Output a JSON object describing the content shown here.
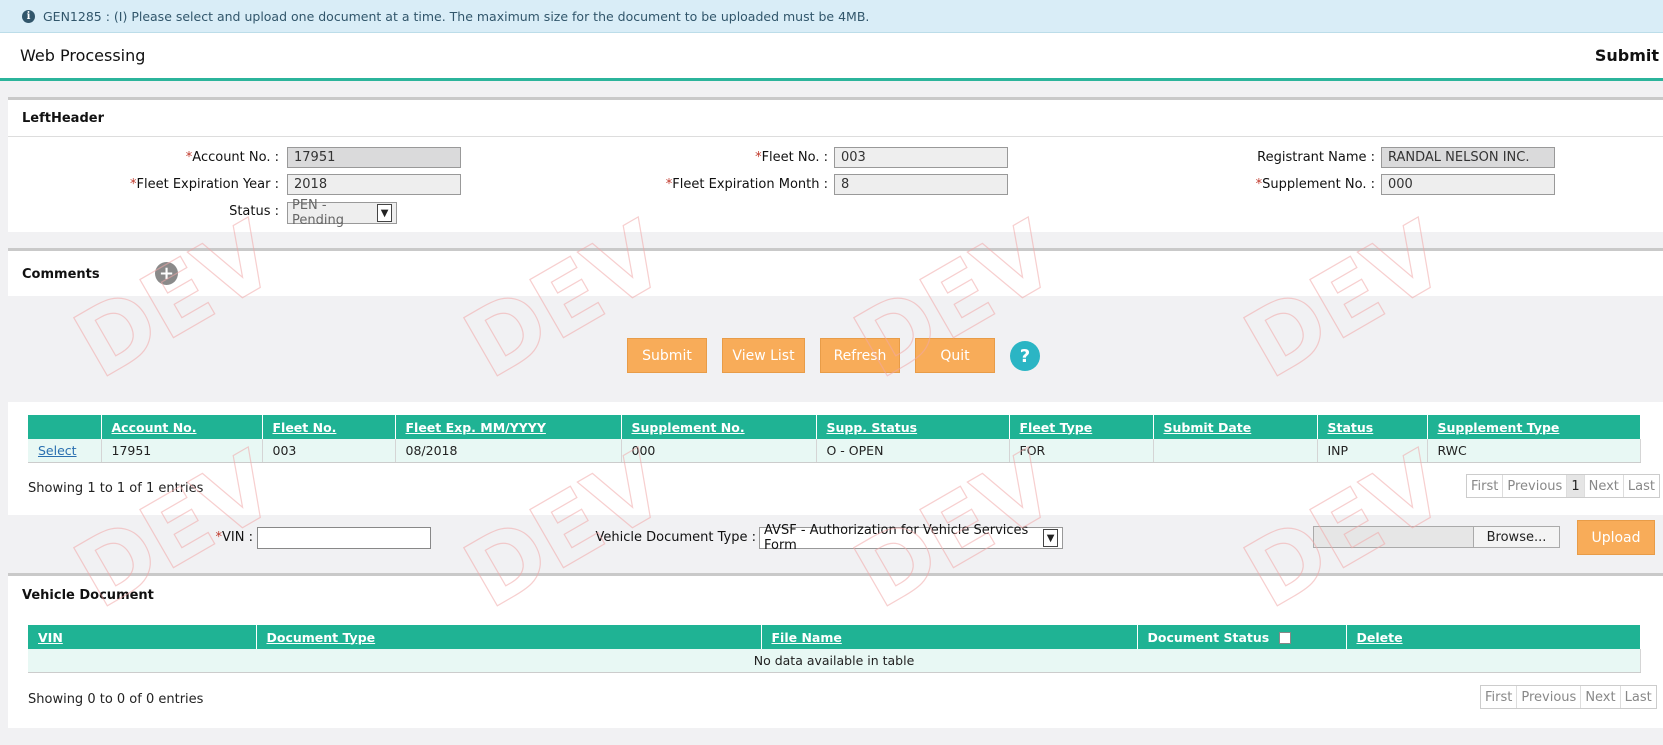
{
  "message": {
    "icon": "info-icon",
    "text": "GEN1285 : (I) Please select and upload one document at a time. The maximum size for the document to be uploaded must be 4MB."
  },
  "header": {
    "title": "Web Processing",
    "action": "Submit"
  },
  "left_header": {
    "title": "LeftHeader",
    "account_no": {
      "label": "Account No. :",
      "value": "17951"
    },
    "fleet_expiration_year": {
      "label": "Fleet Expiration Year :",
      "value": "2018"
    },
    "status": {
      "label": "Status :",
      "value": "PEN - Pending"
    },
    "fleet_no": {
      "label": "Fleet No. :",
      "value": "003"
    },
    "fleet_expiration_month": {
      "label": "Fleet Expiration Month :",
      "value": "8"
    },
    "registrant_name": {
      "label": "Registrant Name :",
      "value": "RANDAL NELSON INC."
    },
    "supplement_no": {
      "label": "Supplement No. :",
      "value": "000"
    },
    "required_mark": "*"
  },
  "comments": {
    "title": "Comments",
    "add_icon": "plus-circle-icon"
  },
  "buttons": {
    "submit": "Submit",
    "view_list": "View List",
    "refresh": "Refresh",
    "quit": "Quit",
    "help": "?"
  },
  "fleet_table": {
    "columns": [
      "",
      "Account No.",
      "Fleet No.",
      "Fleet Exp. MM/YYYY",
      "Supplement No.",
      "Supp. Status",
      "Fleet Type",
      "Submit Date",
      "Status",
      "Supplement Type"
    ],
    "rows": [
      [
        "Select",
        "17951",
        "003",
        "08/2018",
        "000",
        "O - OPEN",
        "FOR",
        "",
        "INP",
        "RWC"
      ]
    ],
    "showing": "Showing 1 to 1 of 1 entries",
    "pager": {
      "first": "First",
      "previous": "Previous",
      "page": "1",
      "next": "Next",
      "last": "Last"
    }
  },
  "upload": {
    "vin_label": "VIN :",
    "vin_value": "",
    "doc_type_label": "Vehicle Document Type :",
    "doc_type_value": "AVSF - Authorization for Vehicle Services Form",
    "browse": "Browse...",
    "upload": "Upload"
  },
  "vehicle_document": {
    "title": "Vehicle Document",
    "columns": [
      "VIN",
      "Document Type",
      "File Name",
      "Document Status",
      "Delete"
    ],
    "empty": "No data available in table",
    "showing": "Showing 0 to 0 of 0 entries",
    "pager": {
      "first": "First",
      "previous": "Previous",
      "next": "Next",
      "last": "Last"
    }
  },
  "watermark": {
    "text": "DEV",
    "color": "#f3c6c6"
  }
}
